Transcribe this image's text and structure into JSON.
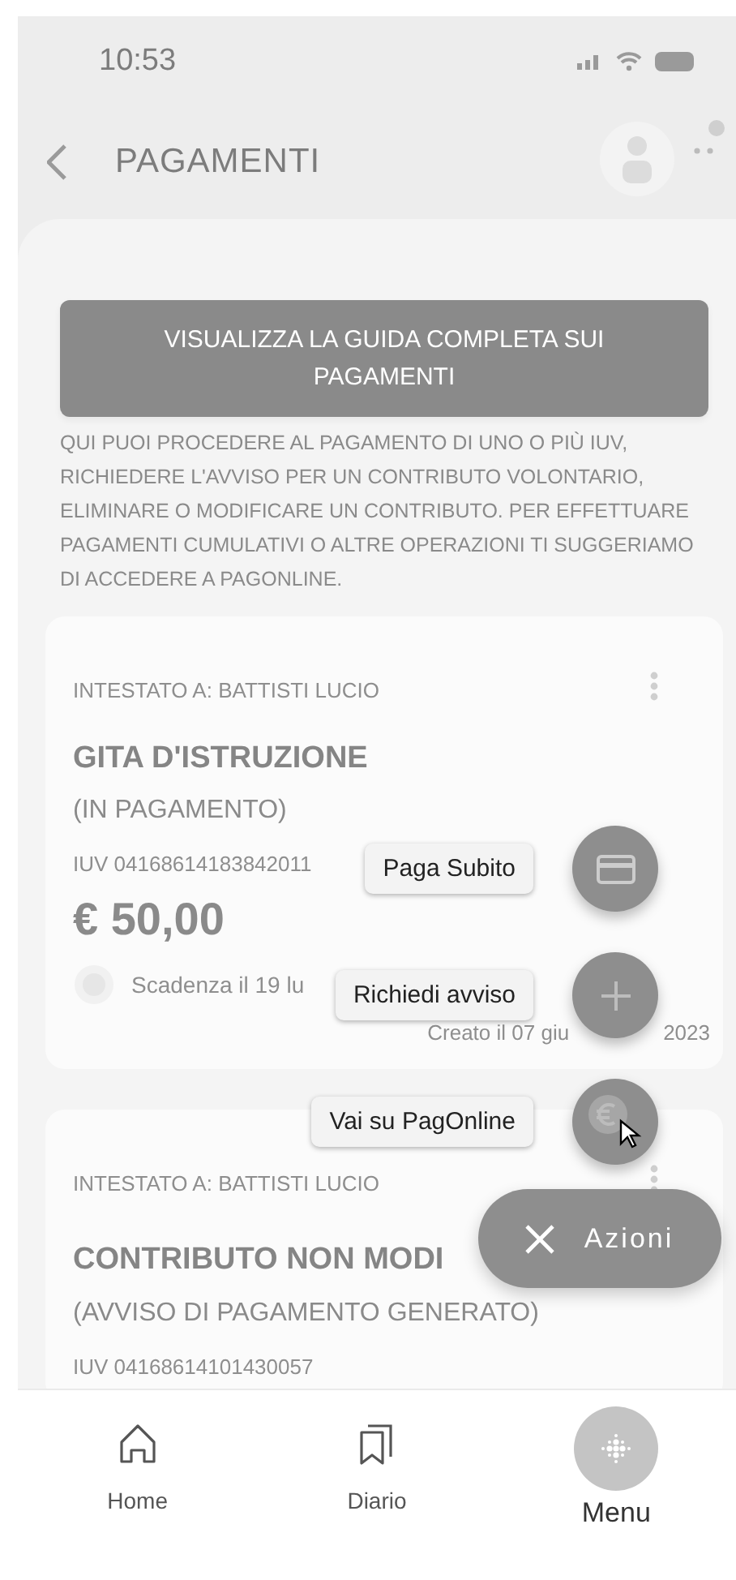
{
  "status_bar": {
    "time": "10:53"
  },
  "header": {
    "title": "PAGAMENTI"
  },
  "guide_button": {
    "label": "VISUALIZZA LA GUIDA COMPLETA SUI PAGAMENTI"
  },
  "intro": "QUI PUOI PROCEDERE AL PAGAMENTO DI UNO O PIÙ IUV, RICHIEDERE L'AVVISO PER UN CONTRIBUTO VOLONTARIO, ELIMINARE O MODIFICARE UN CONTRIBUTO. PER EFFETTUARE PAGAMENTI CUMULATIVI O ALTRE OPERAZIONI TI SUGGERIAMO DI ACCEDERE A PAGONLINE.",
  "cards": [
    {
      "holder": "INTESTATO A: BATTISTI LUCIO",
      "title": "GITA D'ISTRUZIONE",
      "status": "(IN PAGAMENTO)",
      "iuv": "IUV 04168614183842011",
      "amount": "€ 50,00",
      "due": "Scadenza il 19 lu",
      "created": "Creato il 07 giu",
      "created_year": "2023"
    },
    {
      "holder": "INTESTATO A: BATTISTI LUCIO",
      "title": "CONTRIBUTO NON MODI",
      "status": "(AVVISO DI PAGAMENTO GENERATO)",
      "iuv": "IUV 04168614101430057"
    }
  ],
  "fab_actions": [
    {
      "label": "Paga Subito",
      "kind": "card"
    },
    {
      "label": "Richiedi avviso",
      "kind": "plus"
    },
    {
      "label": "Vai su PagOnline",
      "kind": "euro"
    }
  ],
  "fab_toggle": {
    "label": "Azioni",
    "expanded": true
  },
  "nav": [
    {
      "label": "Home",
      "kind": "home",
      "selected": false
    },
    {
      "label": "Diario",
      "kind": "diary",
      "selected": false
    },
    {
      "label": "Menu",
      "kind": "menu",
      "selected": true
    }
  ]
}
